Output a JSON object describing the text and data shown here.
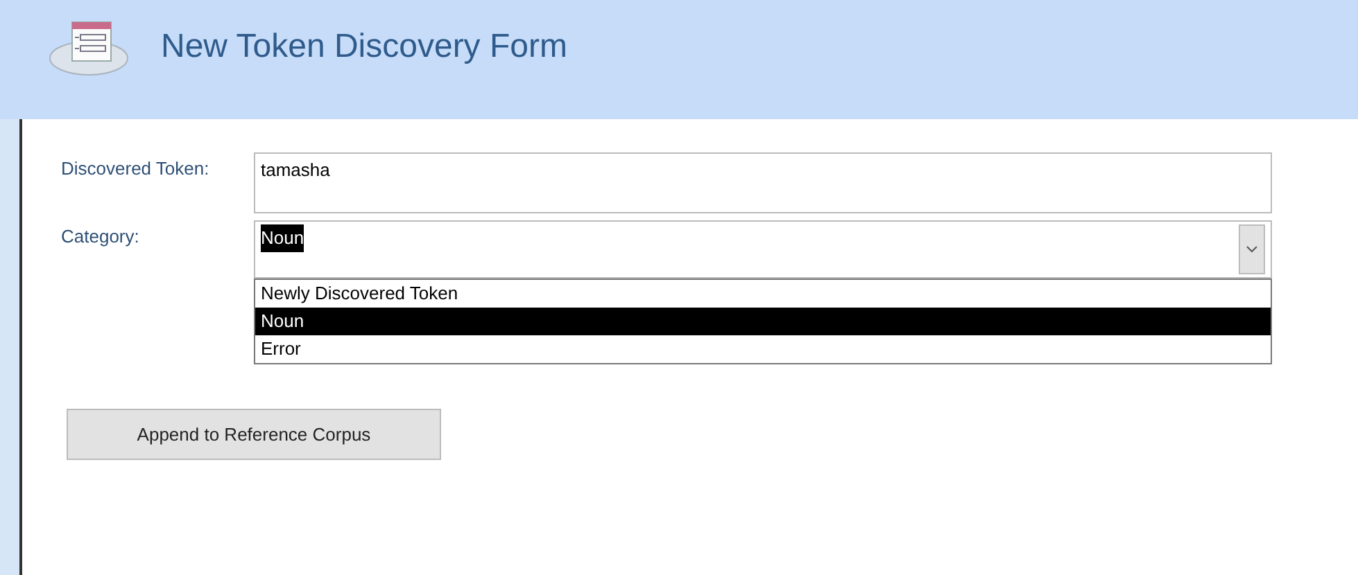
{
  "form": {
    "title": "New Token Discovery Form"
  },
  "token_field": {
    "label": "Discovered Token:",
    "value": "tamasha"
  },
  "category_field": {
    "label": "Category:",
    "value": "Noun",
    "expanded": true
  },
  "category_options": [
    {
      "label": "Newly Discovered Token",
      "selected": false
    },
    {
      "label": "Noun",
      "selected": true
    },
    {
      "label": "Error",
      "selected": false
    }
  ],
  "buttons": [
    "Append to Reference Corpus"
  ]
}
